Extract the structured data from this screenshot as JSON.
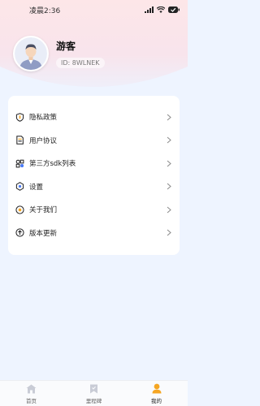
{
  "status_bar": {
    "time": "凌晨2:36"
  },
  "profile": {
    "name": "游客",
    "id_text": "ID: 8WLNEK"
  },
  "menu": [
    {
      "label": "隐私政策",
      "icon": "shield-icon"
    },
    {
      "label": "用户协议",
      "icon": "document-icon"
    },
    {
      "label": "第三方sdk列表",
      "icon": "sdk-icon"
    },
    {
      "label": "设置",
      "icon": "settings-icon"
    },
    {
      "label": "关于我们",
      "icon": "info-circle-icon"
    },
    {
      "label": "版本更新",
      "icon": "upgrade-icon"
    }
  ],
  "tabbar": [
    {
      "label": "首页",
      "icon": "home-icon",
      "active": false
    },
    {
      "label": "里程碑",
      "icon": "bookmark-icon",
      "active": false
    },
    {
      "label": "我的",
      "icon": "user-icon",
      "active": true
    }
  ],
  "colors": {
    "accent": "#f5a623",
    "inactive": "#c9ccd6",
    "background": "#eef4ff"
  }
}
